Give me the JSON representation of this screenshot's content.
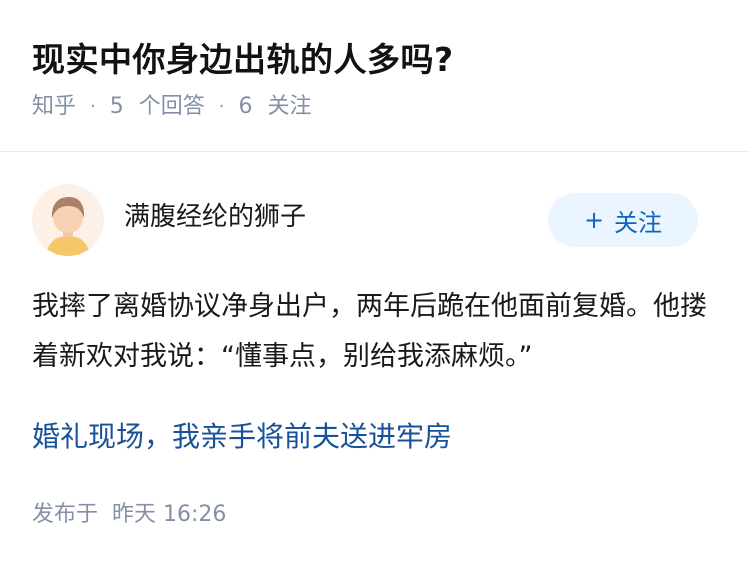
{
  "question": {
    "title": "现实中你身边出轨的人多吗?",
    "source": "知乎",
    "answers_count": "5",
    "answers_label": "个回答",
    "followers_count": "6",
    "followers_label": "关注",
    "separator": "·"
  },
  "answer": {
    "author_name": "满腹经纶的狮子",
    "follow_label": "关注",
    "follow_icon": "plus-icon",
    "text": "我摔了离婚协议净身出户，两年后跪在他面前复婚。他搂着新欢对我说：“懂事点，别给我添麻烦。”",
    "related_link": "婚礼现场，我亲手将前夫送进牢房",
    "publish_label": "发布于",
    "publish_time": "昨天 16:26"
  },
  "colors": {
    "meta_gray": "#8590a6",
    "link_blue": "#175199",
    "follow_bg": "#ebf5ff",
    "follow_text": "#0a66c2"
  }
}
